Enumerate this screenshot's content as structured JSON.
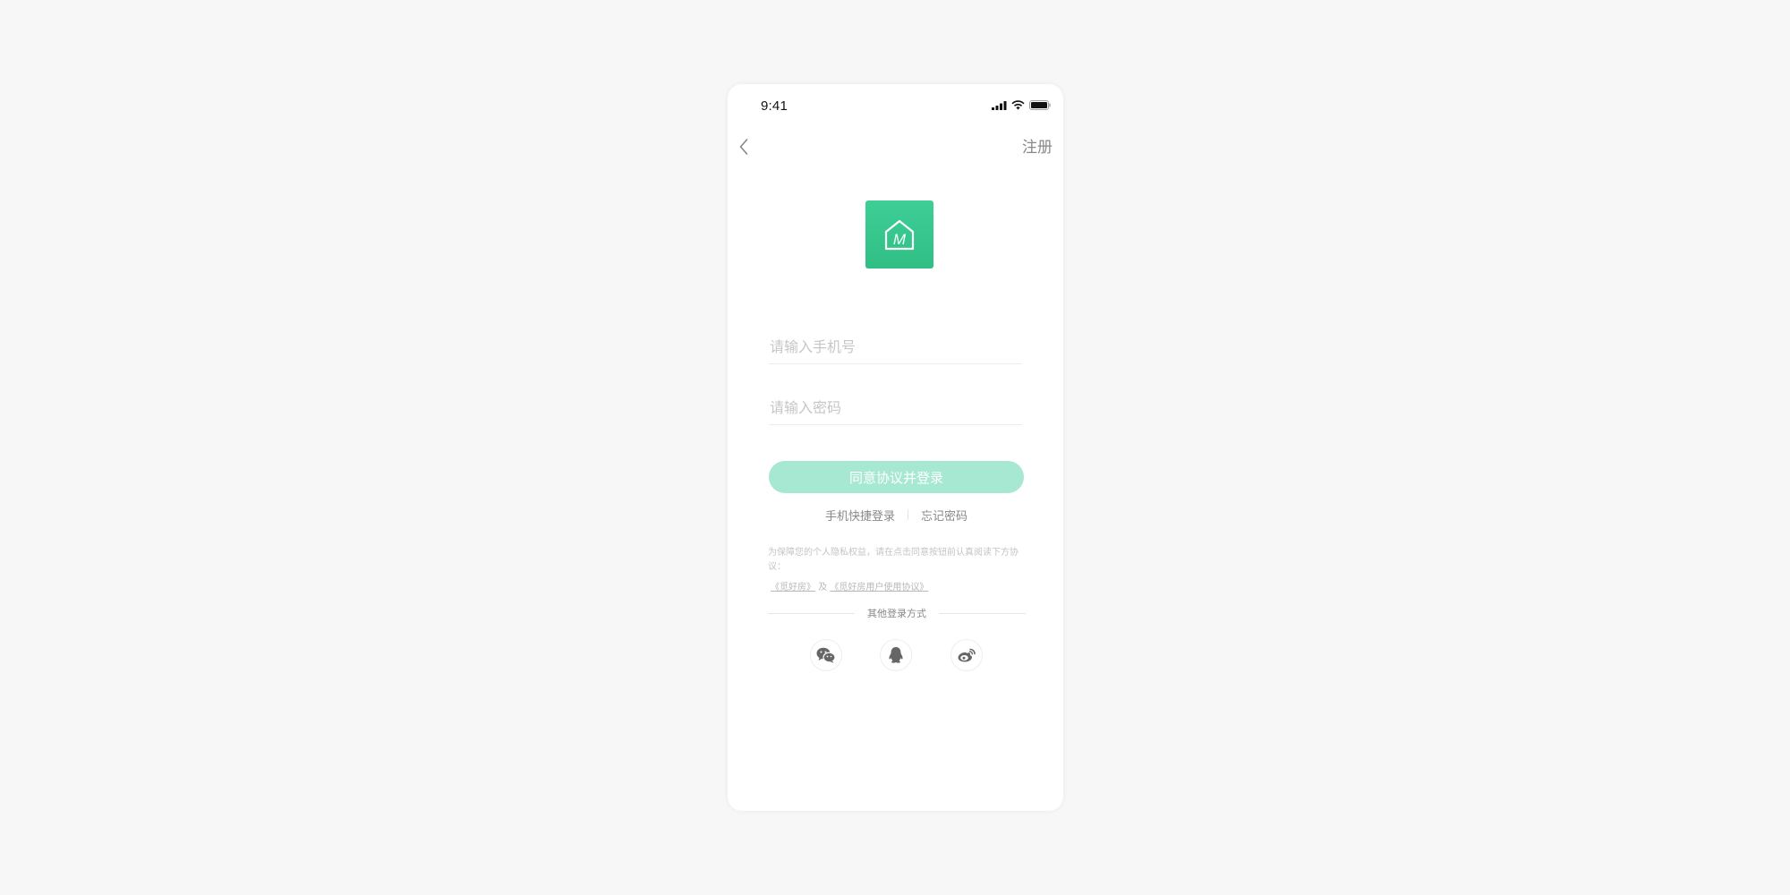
{
  "status_bar": {
    "time": "9:41"
  },
  "nav": {
    "back_icon": "chevron-left-icon",
    "register_label": "注册"
  },
  "logo": {
    "icon": "house-m-logo",
    "letter": "M",
    "color": "#3cc98f"
  },
  "form": {
    "phone_placeholder": "请输入手机号",
    "phone_value": "",
    "password_placeholder": "请输入密码",
    "password_value": "",
    "login_button_label": "同意协议并登录"
  },
  "links": {
    "quick_login": "手机快捷登录",
    "forgot_password": "忘记密码"
  },
  "agreement": {
    "notice": "为保障您的个人隐私权益，请在点击同意按钮前认真阅读下方协议：",
    "privacy_link": "《觅好房》",
    "conjunction": "及",
    "terms_link": "《觅好房用户使用协议》"
  },
  "other_login": {
    "label": "其他登录方式",
    "methods": [
      {
        "icon": "wechat-icon"
      },
      {
        "icon": "qq-icon"
      },
      {
        "icon": "weibo-icon"
      }
    ]
  },
  "colors": {
    "accent": "#3ecf96",
    "button_disabled": "#a7e8d2",
    "background": "#f7f7f7"
  }
}
